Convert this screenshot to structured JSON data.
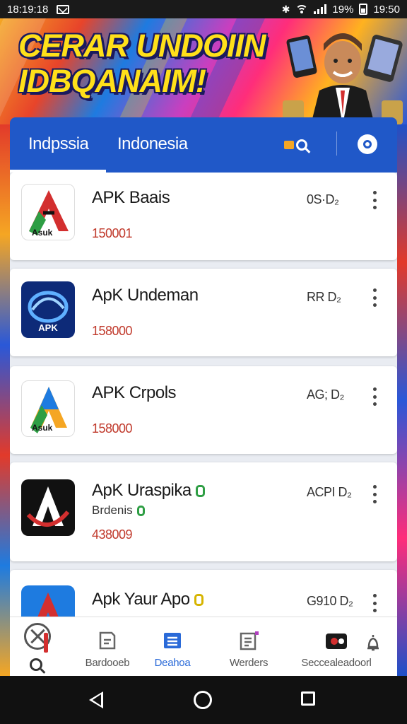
{
  "status_bar": {
    "time_left": "18:19:18",
    "battery": "19%",
    "clock": "19:50"
  },
  "banner": {
    "title_line1": "CERAR UNDOIIN",
    "title_line2": "IDBQANAIM!"
  },
  "tabs": [
    {
      "label": "Indpssia"
    },
    {
      "label": "Indonesia"
    }
  ],
  "apps": [
    {
      "name": "APK Baais",
      "sub": "",
      "count": "150001",
      "meta": "0S·D₂",
      "icon": "apk-baais-icon",
      "badge": ""
    },
    {
      "name": "ApK Undeman",
      "sub": "",
      "count": "158000",
      "meta": "RR D₂",
      "icon": "apk-undeman-icon",
      "badge": ""
    },
    {
      "name": "APK Crpols",
      "sub": "",
      "count": "158000",
      "meta": "AG; D₂",
      "icon": "apk-crpols-icon",
      "badge": ""
    },
    {
      "name": "ApK Uraspika",
      "sub": "Brdenis",
      "count": "438009",
      "meta": "ACPI D₂",
      "icon": "apk-uraspika-icon",
      "badge": "green"
    },
    {
      "name": "Apk Yaur Apo",
      "sub": "",
      "count": "",
      "meta": "G910 D₂",
      "icon": "apk-yaur-apo-icon",
      "badge": "yellow"
    }
  ],
  "colors": {
    "tabbar": "#2058c8",
    "count_text": "#c0392b",
    "active_nav": "#2a6ad8",
    "badge_green": "#2e9e44",
    "badge_yellow": "#d6b400"
  },
  "bottom_nav": [
    {
      "label": "",
      "icon": "tools-fab-icon"
    },
    {
      "label": "Bardooeb",
      "icon": "document-icon"
    },
    {
      "label": "Deahoa",
      "icon": "list-icon",
      "active": true
    },
    {
      "label": "Werders",
      "icon": "notes-icon"
    },
    {
      "label": "Seccealeadoorl",
      "icon": "camera-icon"
    },
    {
      "label": "",
      "icon": "bell-icon"
    }
  ]
}
